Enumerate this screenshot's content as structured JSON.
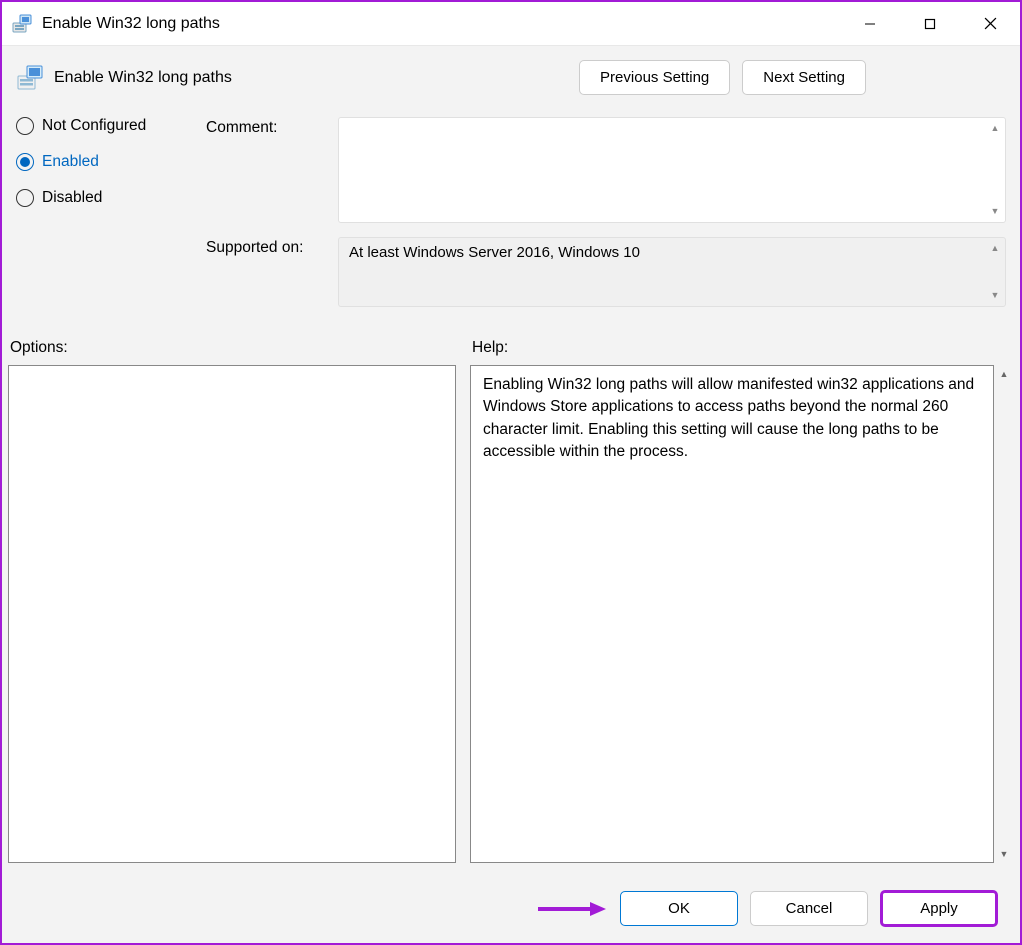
{
  "window": {
    "title": "Enable Win32 long paths"
  },
  "header": {
    "policy_title": "Enable Win32 long paths",
    "prev_label": "Previous Setting",
    "next_label": "Next Setting"
  },
  "config": {
    "radios": {
      "not_configured": "Not Configured",
      "enabled": "Enabled",
      "disabled": "Disabled",
      "selected": "enabled"
    },
    "comment_label": "Comment:",
    "comment_value": "",
    "supported_label": "Supported on:",
    "supported_value": "At least Windows Server 2016, Windows 10"
  },
  "panes": {
    "options_label": "Options:",
    "help_label": "Help:",
    "help_text": "Enabling Win32 long paths will allow manifested win32 applications and Windows Store applications to access paths beyond the normal 260 character limit.  Enabling this setting will cause the long paths to be accessible within the process."
  },
  "footer": {
    "ok": "OK",
    "cancel": "Cancel",
    "apply": "Apply"
  }
}
